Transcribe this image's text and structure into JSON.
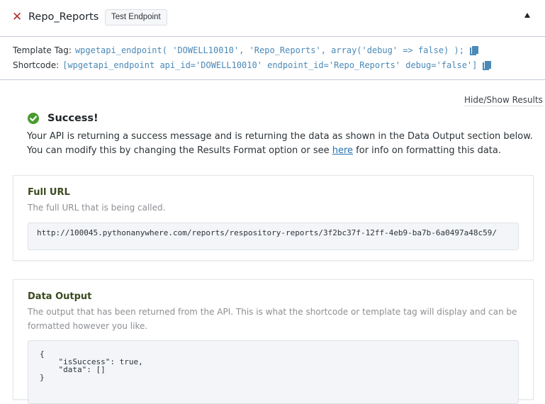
{
  "header": {
    "endpoint_name": "Repo_Reports",
    "test_button_label": "Test Endpoint",
    "close_icon": "close-x-icon",
    "toggle_icon": "caret-up-icon"
  },
  "tags": {
    "template_tag_label": "Template Tag:",
    "template_tag_code": "wpgetapi_endpoint( 'DOWELL10010', 'Repo_Reports', array('debug' => false) );",
    "shortcode_label": "Shortcode:",
    "shortcode_code": "[wpgetapi_endpoint api_id='DOWELL10010' endpoint_id='Repo_Reports' debug='false']",
    "copy_icon": "copy-icon"
  },
  "results": {
    "hide_show_label": "Hide/Show Results",
    "success_title": "Success!",
    "success_line1": "Your API is returning a success message and is returning the data as shown in the Data Output section below.",
    "success_line2_before": "You can modify this by changing the Results Format option or see ",
    "success_link": "here",
    "success_line2_after": " for info on formatting this data."
  },
  "full_url": {
    "title": "Full URL",
    "description": "The full URL that is being called.",
    "value": "http://100045.pythonanywhere.com/reports/respository-reports/3f2bc37f-12ff-4eb9-ba7b-6a0497a48c59/"
  },
  "data_output": {
    "title": "Data Output",
    "description": "The output that has been returned from the API. This is what the shortcode or template tag will display and can be formatted however you like.",
    "value": "{\n    \"isSuccess\": true,\n    \"data\": []\n}"
  },
  "colors": {
    "accent": "#4b89b6",
    "success": "#4a9b2f",
    "error": "#b32d2e",
    "link": "#2271b1"
  }
}
